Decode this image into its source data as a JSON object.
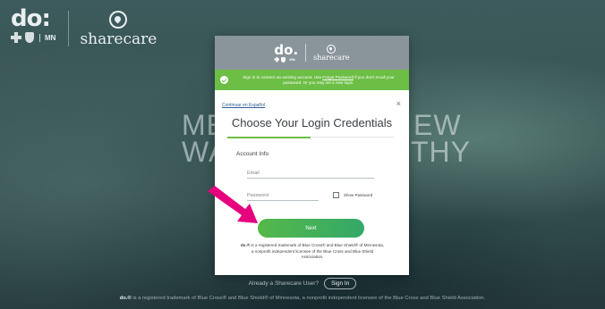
{
  "brand": {
    "do_text": "do",
    "mn_text": "MN",
    "sharecare_text": "sharecare"
  },
  "hero": {
    "line1_left": "ME",
    "line2_left": "WA",
    "line1_right": "EW",
    "line2_right": "THY"
  },
  "modal": {
    "do_text": "do.",
    "mn_text": "MN",
    "sharecare_text": "sharecare",
    "banner": {
      "text_before_link": "Sign in to connect an existing account. Use ",
      "link_text": "Forgot Password",
      "text_after_link": " if you don't recall your password. Or you may set a new login."
    },
    "language_link": "Continuar en Español",
    "close_label": "×",
    "title": "Choose Your Login Credentials",
    "progress_fraction": 0.5,
    "section_label": "Account Info",
    "email_placeholder": "Email",
    "password_placeholder": "Password",
    "show_password_label": "Show Password",
    "next_label": "Next",
    "trademark_bold": "do.®",
    "trademark_text": " is a registered trademark of Blue Cross® and Blue Shield® of Minnesota, a nonprofit independent licensee of the Blue Cross and Blue Shield Association."
  },
  "bottom": {
    "already_text": "Already a Sharecare User?",
    "sign_in_label": "Sign In"
  },
  "footer": {
    "bold": "do.®",
    "text": " is a registered trademark of Blue Cross® and Blue Shield® of Minnesota, a nonprofit independent licensee of the Blue Cross and Blue Shield Association."
  },
  "colors": {
    "banner_green": "#6cbe45",
    "arrow_pink": "#e6007e",
    "modal_header_gray": "#8a959b"
  }
}
